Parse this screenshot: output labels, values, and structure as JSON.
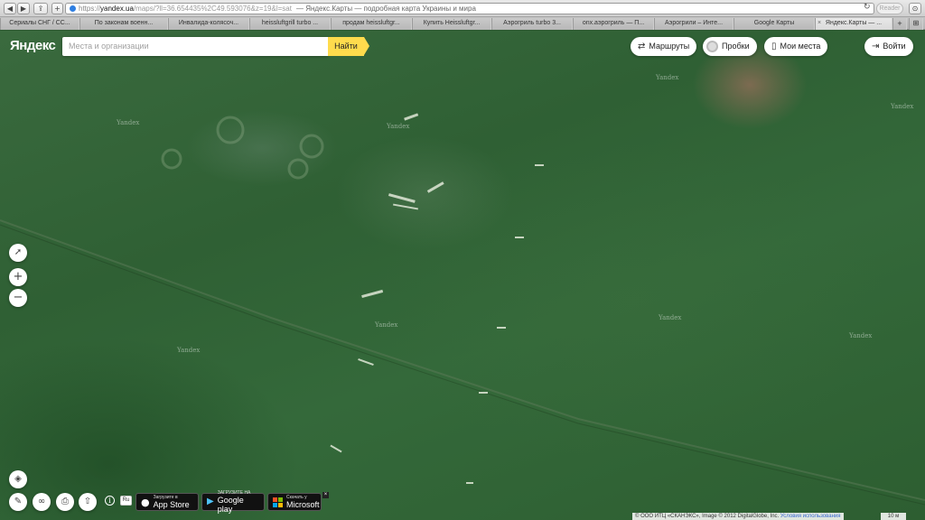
{
  "browser": {
    "url": {
      "scheme": "https://",
      "host": "yandex.ua",
      "path": "/maps/?ll=36.654435%2C49.593076&z=19&l=sat",
      "title": "— Яндекс.Карты — подробная карта Украины и мира"
    },
    "reader_label": "Reader",
    "tabs": [
      "Сериалы СНГ / СС...",
      "По законам военн...",
      "Инвалида-колясоч...",
      "heissluftgrill turbo ...",
      "продам heissluftgr...",
      "Купить Heissluftgr...",
      "Аэрогриль turbo 3...",
      "onx.аэрогриль — П...",
      "Аэрогрили – Инте...",
      "Google Карты",
      "Яндекс.Карты — ..."
    ]
  },
  "app": {
    "logo": "Яндекс",
    "search_placeholder": "Места и организации",
    "search_button": "Найти",
    "buttons": {
      "routes": "Маршруты",
      "traffic": "Пробки",
      "my_places": "Мои места",
      "login": "Войти"
    },
    "icons": {
      "routes": "route-icon",
      "traffic": "traffic-icon",
      "my_places": "bookmark-icon",
      "login": "login-icon"
    }
  },
  "map": {
    "watermark": "Yandex",
    "controls": {
      "zoom_in": "+",
      "zoom_out": "−"
    },
    "language_button": "Ru",
    "stores": [
      {
        "small": "Загрузите в",
        "large": "App Store"
      },
      {
        "small": "ЗАГРУЗИТЕ НА",
        "large": "Google play"
      },
      {
        "small": "Скачать у",
        "large": "Microsoft"
      }
    ],
    "copyright": "© ООО ИТЦ «СКАНЭКС», Image © 2012 DigitalGlobe, Inc.",
    "terms_link": "Условия использования",
    "scale": "10 м"
  }
}
